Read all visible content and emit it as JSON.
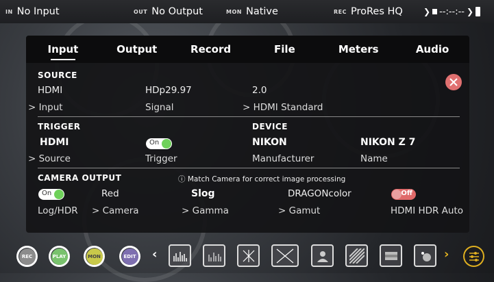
{
  "topbar": {
    "in_tag": "IN",
    "in_val": "No Input",
    "out_tag": "OUT",
    "out_val": "No Output",
    "mon_tag": "MON",
    "mon_val": "Native",
    "rec_tag": "REC",
    "rec_val": "ProRes HQ",
    "timecode": "--:--:--"
  },
  "tabs": [
    "Input",
    "Output",
    "Record",
    "File",
    "Meters",
    "Audio"
  ],
  "source": {
    "title": "SOURCE",
    "input_value": "HDMI",
    "input_label": "> Input",
    "signal_value": "HDp29.97",
    "signal_label": "Signal",
    "standard_value": "2.0",
    "standard_label": "> HDMI Standard"
  },
  "trigger": {
    "title": "TRIGGER",
    "source_value": "HDMI",
    "source_label": "> Source",
    "toggle_label": "On",
    "trigger_label": "Trigger"
  },
  "device": {
    "title": "DEVICE",
    "manufacturer_value": "NIKON",
    "manufacturer_label": "Manufacturer",
    "name_value": "NIKON Z 7",
    "name_label": "Name"
  },
  "camera_output": {
    "title": "CAMERA OUTPUT",
    "note": "ⓘ Match Camera for correct image processing",
    "loghdr_toggle": "On",
    "loghdr_label": "Log/HDR",
    "camera_value": "Red",
    "camera_label": "> Camera",
    "gamma_value": "Slog",
    "gamma_label": "> Gamma",
    "gamut_value": "DRAGONcolor",
    "gamut_label": "> Gamut",
    "hdmi_toggle": "Off",
    "hdmi_label": "HDMI HDR Auto"
  },
  "bottombar": {
    "rec": "REC",
    "play": "PLAY",
    "mon": "MON",
    "edit": "EDIT"
  },
  "colors": {
    "accent_green": "#6fd15a",
    "off_red": "#e06a6a",
    "rec": "#8c8c8c",
    "play": "#79c26d",
    "mon": "#c9c94a",
    "edit": "#7e6fb0"
  }
}
